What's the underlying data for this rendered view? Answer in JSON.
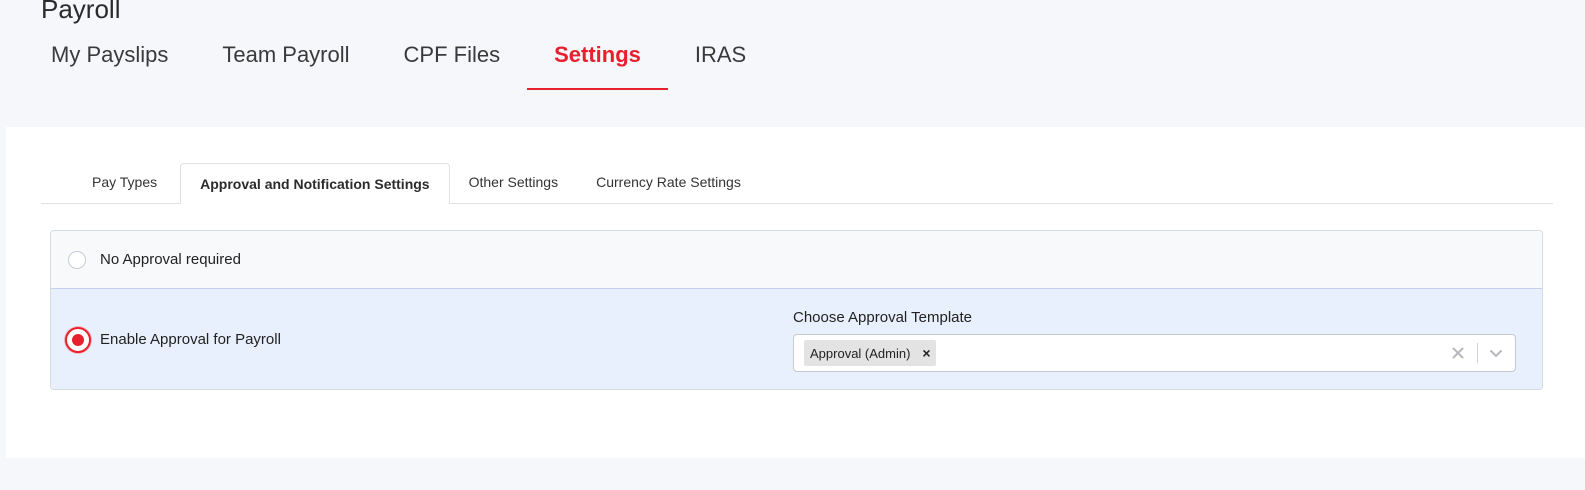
{
  "page": {
    "title": "Payroll"
  },
  "main_tabs": [
    {
      "label": "My Payslips",
      "active": false
    },
    {
      "label": "Team Payroll",
      "active": false
    },
    {
      "label": "CPF Files",
      "active": false
    },
    {
      "label": "Settings",
      "active": true
    },
    {
      "label": "IRAS",
      "active": false
    }
  ],
  "sub_tabs": [
    {
      "label": "Pay Types",
      "active": false
    },
    {
      "label": "Approval and Notification Settings",
      "active": true
    },
    {
      "label": "Other Settings",
      "active": false
    },
    {
      "label": "Currency Rate Settings",
      "active": false
    }
  ],
  "approval": {
    "no_approval_label": "No Approval required",
    "no_approval_selected": false,
    "enable_label": "Enable Approval for Payroll",
    "enable_selected": true,
    "template_label": "Choose Approval Template",
    "selected_templates": [
      {
        "label": "Approval (Admin)"
      }
    ],
    "chip_remove_glyph": "×"
  },
  "colors": {
    "accent": "#e8202e",
    "selected_row_bg": "#e9f0fd",
    "page_bg": "#f6f7fb"
  }
}
